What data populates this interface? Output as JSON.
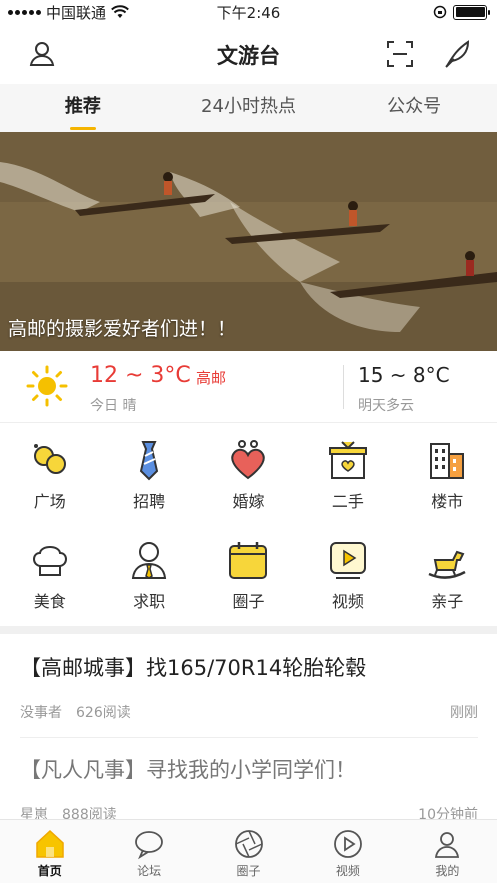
{
  "status": {
    "carrier": "中国联通",
    "time": "下午2:46"
  },
  "header": {
    "title": "文游台",
    "profile_icon": "user-icon",
    "scan_icon": "scan-icon",
    "write_icon": "feather-pen-icon"
  },
  "tabs": [
    {
      "label": "推荐",
      "active": true
    },
    {
      "label": "24小时热点",
      "active": false
    },
    {
      "label": "公众号",
      "active": false
    }
  ],
  "banner": {
    "caption": "高邮的摄影爱好者们进！！"
  },
  "weather": {
    "today_temp": "12 ~ 3°C",
    "city": "高邮",
    "today_label": "今日 晴",
    "tomorrow_temp": "15 ~ 8°C",
    "tomorrow_label": "明天多云",
    "accent": "#e83b36"
  },
  "categories": [
    {
      "label": "广场",
      "icon": "plaza-icon"
    },
    {
      "label": "招聘",
      "icon": "tie-icon"
    },
    {
      "label": "婚嫁",
      "icon": "heart-icon"
    },
    {
      "label": "二手",
      "icon": "box-icon"
    },
    {
      "label": "楼市",
      "icon": "building-icon"
    },
    {
      "label": "美食",
      "icon": "chef-hat-icon"
    },
    {
      "label": "求职",
      "icon": "person-tie-icon"
    },
    {
      "label": "圈子",
      "icon": "calendar-icon"
    },
    {
      "label": "视频",
      "icon": "play-icon"
    },
    {
      "label": "亲子",
      "icon": "rocking-horse-icon"
    }
  ],
  "news": [
    {
      "title": "【高邮城事】找165/70R14轮胎轮毂",
      "author": "没事者",
      "reads": "626阅读",
      "time": "刚刚"
    },
    {
      "title": "【凡人凡事】寻找我的小学同学们！",
      "author": "星崽",
      "reads": "888阅读",
      "time": "10分钟前"
    }
  ],
  "tabbar": [
    {
      "label": "首页",
      "icon": "home-icon",
      "active": true
    },
    {
      "label": "论坛",
      "icon": "chat-bubble-icon",
      "active": false
    },
    {
      "label": "圈子",
      "icon": "aperture-icon",
      "active": false
    },
    {
      "label": "视频",
      "icon": "play-circle-icon",
      "active": false
    },
    {
      "label": "我的",
      "icon": "user-icon",
      "active": false
    }
  ],
  "colors": {
    "accent": "#f5b400",
    "heart": "#e8615a"
  }
}
